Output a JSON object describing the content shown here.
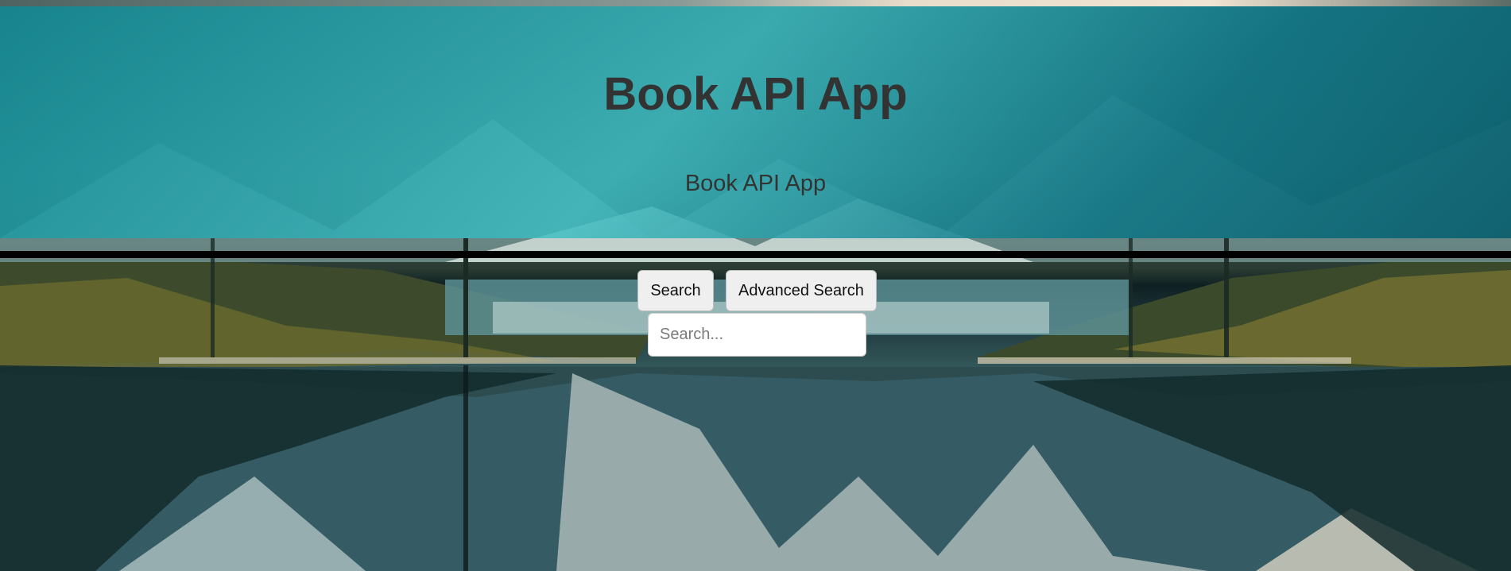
{
  "header": {
    "title": "Book API App",
    "subtitle": "Book API App"
  },
  "search": {
    "search_button_label": "Search",
    "advanced_button_label": "Advanced Search",
    "placeholder": "Search...",
    "value": ""
  },
  "colors": {
    "header_overlay": "#1a9aa5",
    "title_text": "#333333",
    "divider": "#000000",
    "button_bg": "#efefef"
  }
}
